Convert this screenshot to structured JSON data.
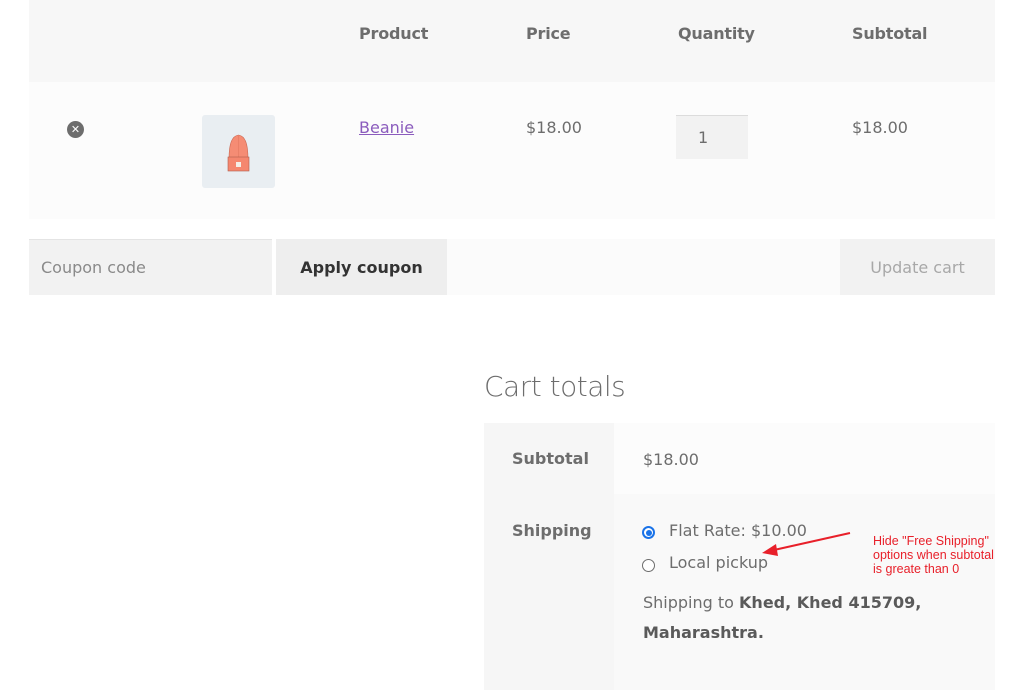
{
  "cart": {
    "headers": {
      "product": "Product",
      "price": "Price",
      "quantity": "Quantity",
      "subtotal": "Subtotal"
    },
    "items": [
      {
        "name": "Beanie",
        "price": "$18.00",
        "quantity": "1",
        "subtotal": "$18.00",
        "remove_icon": "circle-x-icon",
        "thumbnail": "beanie-image"
      }
    ]
  },
  "actions": {
    "coupon_placeholder": "Coupon code",
    "apply_coupon_label": "Apply coupon",
    "update_cart_label": "Update cart"
  },
  "totals": {
    "title": "Cart totals",
    "subtotal_label": "Subtotal",
    "subtotal_value": "$18.00",
    "shipping_label": "Shipping",
    "shipping_options": [
      {
        "label": "Flat Rate: $10.00",
        "checked": true
      },
      {
        "label": "Local pickup",
        "checked": false
      }
    ],
    "shipping_to_prefix": "Shipping to ",
    "shipping_to_address": "Khed, Khed 415709, Maharashtra",
    "shipping_to_suffix": "."
  },
  "annotation": {
    "lines": [
      "Hide \"Free Shipping\"",
      "options when subtotal",
      "is greate than 0"
    ],
    "color": "#e8202a"
  },
  "colors": {
    "link": "#8b5cbd",
    "radio_accent": "#1a73e8",
    "text": "#6d6d6d"
  }
}
